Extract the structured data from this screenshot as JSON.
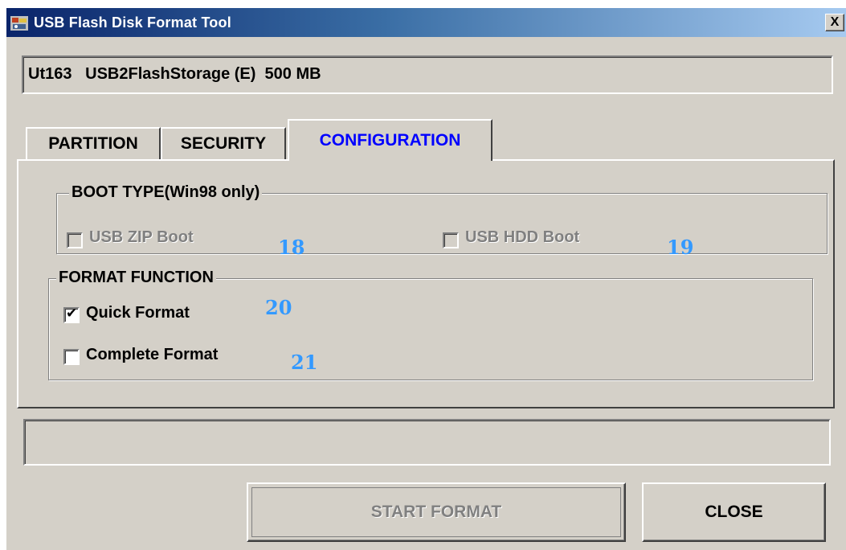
{
  "window": {
    "title": "USB Flash Disk Format Tool",
    "close_glyph": "X",
    "icon": "app-usb-tool-icon"
  },
  "device": {
    "text": "Ut163   USB2FlashStorage (E)  500 MB"
  },
  "tabs": [
    {
      "label": "PARTITION",
      "active": false
    },
    {
      "label": "SECURITY",
      "active": false
    },
    {
      "label": "CONFIGURATION",
      "active": true
    }
  ],
  "boot_type": {
    "legend": "BOOT TYPE(Win98 only)",
    "options": [
      {
        "label": "USB ZIP Boot",
        "checked": false,
        "enabled": false,
        "annotation": "18"
      },
      {
        "label": "USB HDD Boot",
        "checked": false,
        "enabled": false,
        "annotation": "19"
      }
    ]
  },
  "format_function": {
    "legend": "FORMAT FUNCTION",
    "options": [
      {
        "label": "Quick Format",
        "checked": true,
        "enabled": true,
        "annotation": "20"
      },
      {
        "label": "Complete Format",
        "checked": false,
        "enabled": true,
        "annotation": "21"
      }
    ]
  },
  "status": {
    "text": ""
  },
  "buttons": {
    "start_format": "START FORMAT",
    "close": "CLOSE"
  },
  "colors": {
    "active_tab": "#0000ff",
    "annotation": "#3399ff",
    "face": "#d4d0c8"
  }
}
